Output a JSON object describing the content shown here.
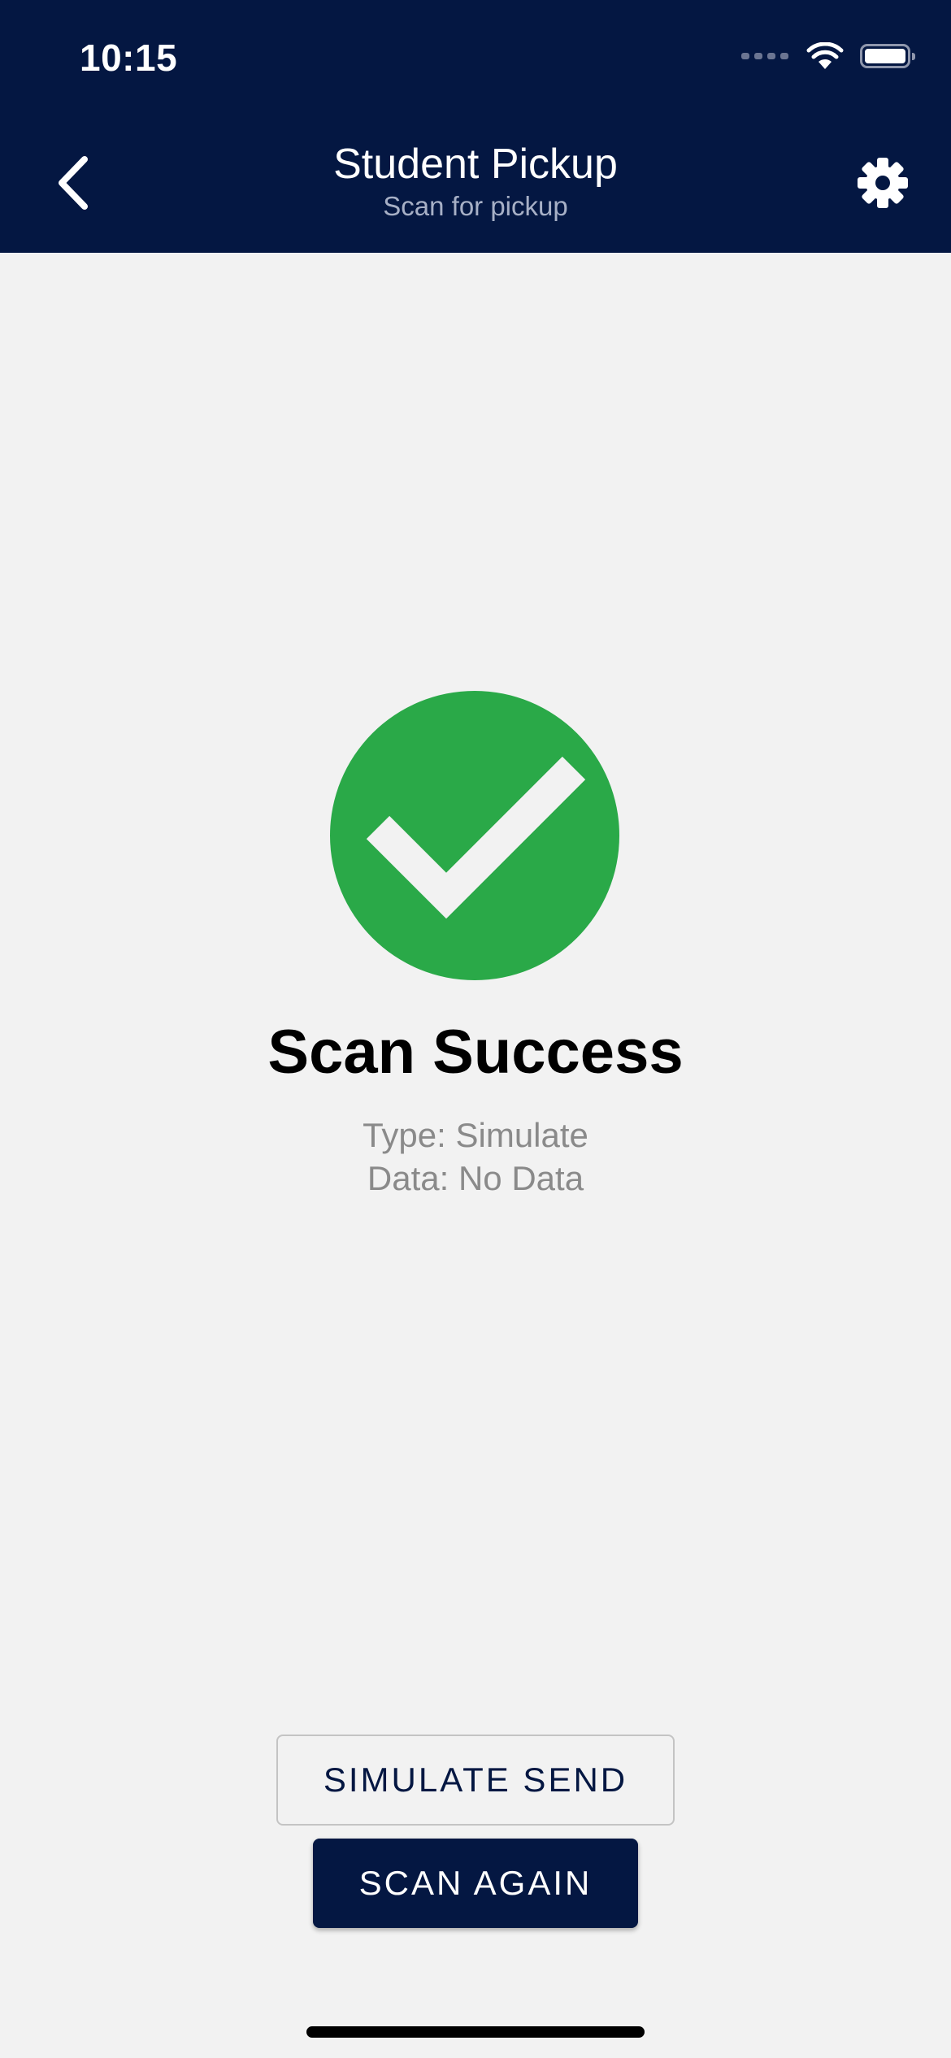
{
  "status_bar": {
    "time": "10:15",
    "icons": [
      "cellular-signal-icon",
      "wifi-icon",
      "battery-icon"
    ]
  },
  "header": {
    "title": "Student Pickup",
    "subtitle": "Scan for pickup",
    "back_icon": "chevron-left-icon",
    "settings_icon": "gear-icon"
  },
  "result": {
    "icon": "check-circle-icon",
    "title": "Scan Success",
    "type_line": "Type: Simulate",
    "data_line": "Data: No Data"
  },
  "actions": {
    "simulate_send_label": "SIMULATE SEND",
    "scan_again_label": "SCAN AGAIN"
  },
  "colors": {
    "header_bg": "#041742",
    "page_bg": "#f2f2f2",
    "success_green": "#2aa948",
    "primary_button": "#041742"
  }
}
